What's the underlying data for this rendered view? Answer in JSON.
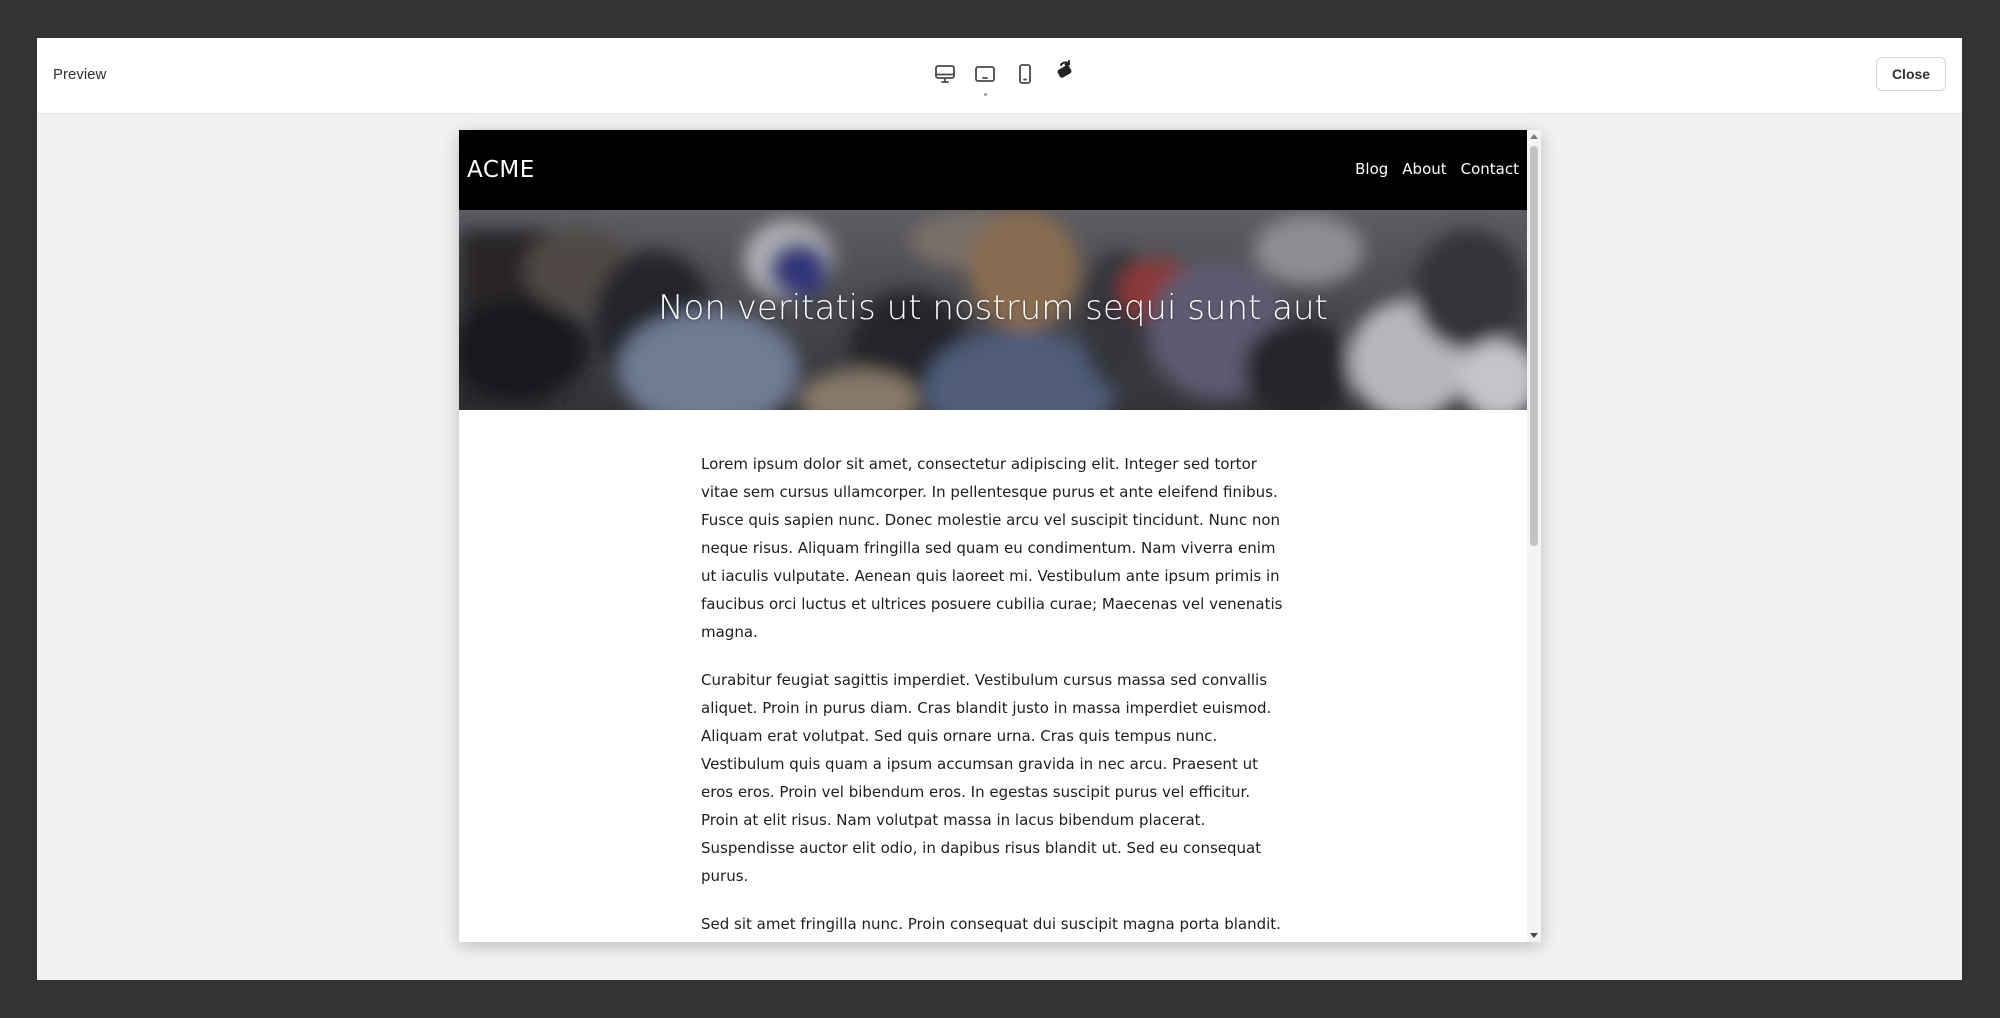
{
  "modal": {
    "title": "Preview",
    "close_label": "Close",
    "devices": [
      "desktop-icon",
      "tablet-icon",
      "mobile-icon",
      "rotate-icon"
    ]
  },
  "site": {
    "logo": "ACME",
    "nav": [
      "Blog",
      "About",
      "Contact"
    ],
    "hero_title": "Non veritatis ut nostrum sequi sunt aut",
    "paragraphs": [
      "Lorem ipsum dolor sit amet, consectetur adipiscing elit. Integer sed tortor vitae sem cursus ullamcorper. In pellentesque purus et ante eleifend finibus. Fusce quis sapien nunc. Donec molestie arcu vel suscipit tincidunt. Nunc non neque risus. Aliquam fringilla sed quam eu condimentum. Nam viverra enim ut iaculis vulputate. Aenean quis laoreet mi. Vestibulum ante ipsum primis in faucibus orci luctus et ultrices posuere cubilia curae; Maecenas vel venenatis magna.",
      "Curabitur feugiat sagittis imperdiet. Vestibulum cursus massa sed convallis aliquet. Proin in purus diam. Cras blandit justo in massa imperdiet euismod. Aliquam erat volutpat. Sed quis ornare urna. Cras quis tempus nunc. Vestibulum quis quam a ipsum accumsan gravida in nec arcu. Praesent ut eros eros. Proin vel bibendum eros. In egestas suscipit purus vel efficitur. Proin at elit risus. Nam volutpat massa in lacus bibendum placerat. Suspendisse auctor elit odio, in dapibus risus blandit ut. Sed eu consequat purus.",
      "Sed sit amet fringilla nunc. Proin consequat dui suscipit magna porta blandit. Nam vel felis commodo, mattis sapien ac, laoreet ligula. Vestibulum egestas cursus nulla in tincidunt. Ut efficitur, purus in faucibus mattis, justo enim mollis"
    ]
  }
}
